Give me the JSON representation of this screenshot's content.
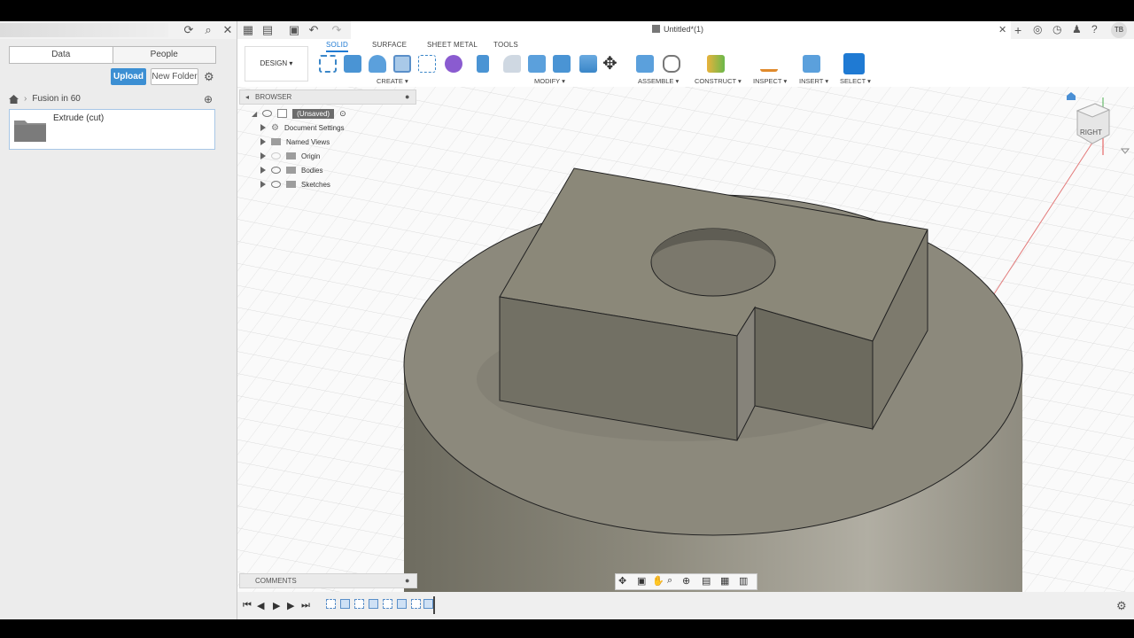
{
  "data_panel": {
    "tabs": [
      "Data",
      "People"
    ],
    "upload_label": "Upload",
    "new_folder_label": "New Folder",
    "breadcrumb": "Fusion in 60",
    "item_title": "Extrude (cut)"
  },
  "titlebar": {
    "document_title": "Untitled*(1)",
    "user_initials": "TB"
  },
  "ribbon": {
    "workspace": "DESIGN",
    "tabs": [
      "SOLID",
      "SURFACE",
      "SHEET METAL",
      "TOOLS"
    ],
    "groups": [
      "CREATE",
      "MODIFY",
      "ASSEMBLE",
      "CONSTRUCT",
      "INSPECT",
      "INSERT",
      "SELECT"
    ]
  },
  "browser": {
    "header": "BROWSER",
    "root": "(Unsaved)",
    "items": [
      "Document Settings",
      "Named Views",
      "Origin",
      "Bodies",
      "Sketches"
    ]
  },
  "comments_label": "COMMENTS",
  "viewcube_face": "RIGHT",
  "colors": {
    "accent": "#1f7ad3",
    "upload_button": "#3c8fd3",
    "model_face": "#8f8c7f",
    "panel_bg": "#ececec"
  }
}
